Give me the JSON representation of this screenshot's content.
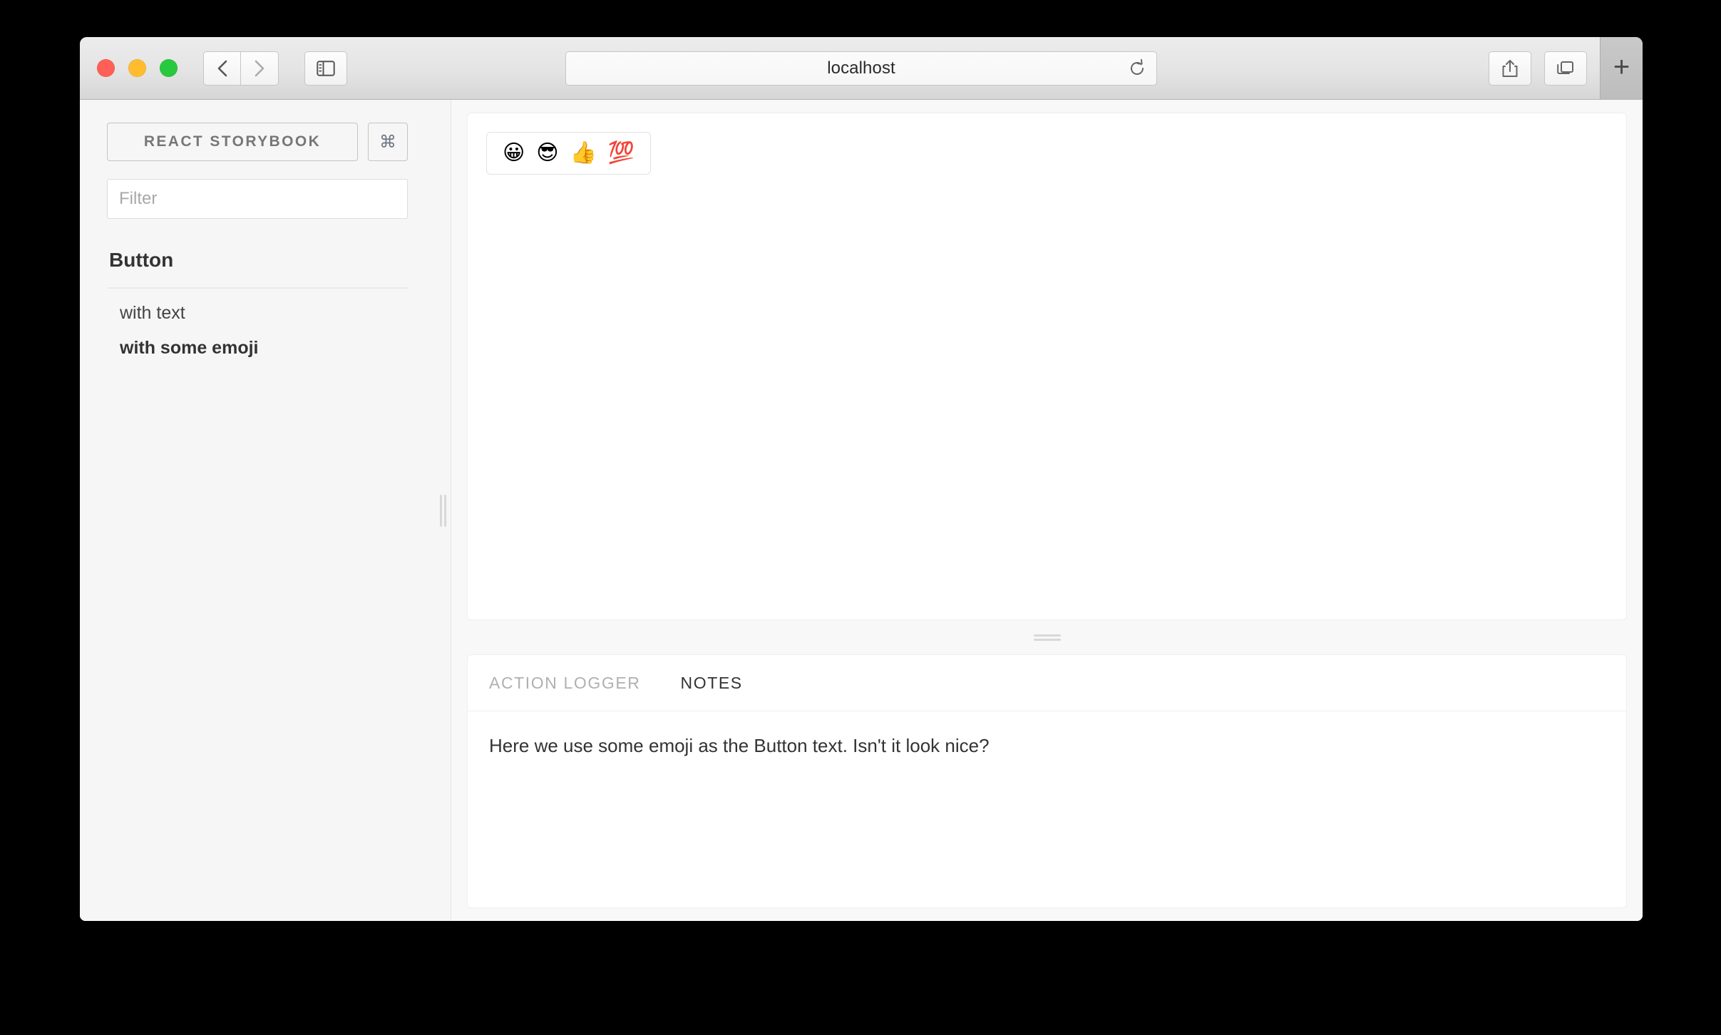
{
  "browser": {
    "title": "localhost",
    "window_controls": [
      {
        "name": "close",
        "color": "#ff5f56"
      },
      {
        "name": "minimize",
        "color": "#febc2e"
      },
      {
        "name": "zoom",
        "color": "#27c93f"
      }
    ],
    "back_icon": "chevron-left-icon",
    "forward_icon": "chevron-right-icon",
    "sidebar_icon": "sidebar-toggle-icon",
    "reload_icon": "reload-icon",
    "share_icon": "share-icon",
    "tabs_icon": "show-all-tabs-icon",
    "newtab_label": "+"
  },
  "sidebar": {
    "brand": "REACT STORYBOOK",
    "shortcut_symbol": "⌘",
    "filter_placeholder": "Filter",
    "filter_value": "",
    "kinds": [
      {
        "name": "Button",
        "stories": [
          {
            "label": "with text",
            "selected": false
          },
          {
            "label": "with some emoji",
            "selected": true
          }
        ]
      }
    ]
  },
  "preview": {
    "button_emoji": [
      "😀",
      "😎",
      "👍",
      "💯"
    ]
  },
  "bottom_panel": {
    "tabs": [
      {
        "label": "ACTION LOGGER",
        "active": false
      },
      {
        "label": "NOTES",
        "active": true
      }
    ],
    "notes_text": "Here we use some emoji as the Button text. Isn't it look nice?"
  },
  "colors": {
    "sidebar_bg": "#f6f6f6",
    "panel_bg": "#ffffff",
    "text": "#333333",
    "muted_text": "#b0b0b0",
    "border": "#eeeeee"
  }
}
